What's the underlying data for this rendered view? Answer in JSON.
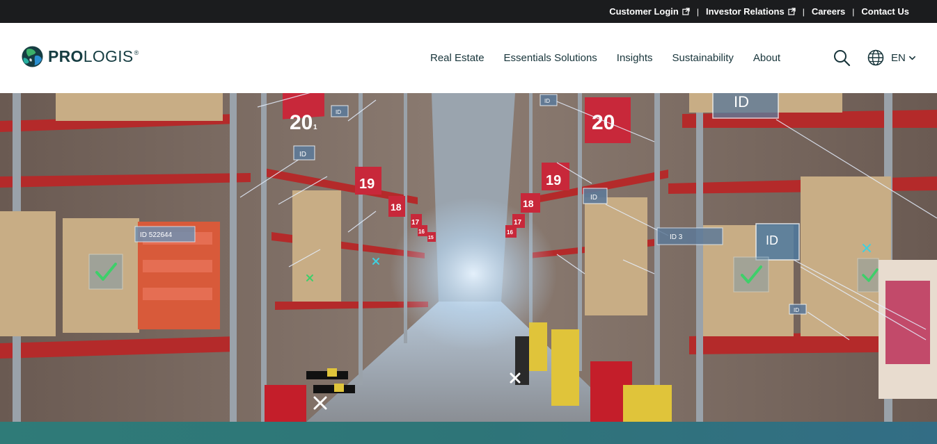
{
  "utility_nav": {
    "links": [
      {
        "label": "Customer Login",
        "external": true
      },
      {
        "label": "Investor Relations",
        "external": true
      },
      {
        "label": "Careers",
        "external": false
      },
      {
        "label": "Contact Us",
        "external": false
      }
    ],
    "separator": "|"
  },
  "brand": {
    "name_bold": "PRO",
    "name_regular": "LOGIS",
    "registered": "®",
    "colors": {
      "dark": "#163d42",
      "teal": "#1f8a7a",
      "blue": "#2a6fb0",
      "green": "#3cb06a"
    }
  },
  "main_nav": {
    "items": [
      "Real Estate",
      "Essentials Solutions",
      "Insights",
      "Sustainability",
      "About"
    ]
  },
  "language": {
    "current": "EN"
  },
  "icons": {
    "search": "search-icon",
    "globe": "globe-icon",
    "chevron": "chevron-down-icon",
    "external": "external-link-icon"
  },
  "hero": {
    "overlay_tags": {
      "left_tag": "ID 522644",
      "right_tag": "ID 3",
      "id_small": "ID",
      "id_large": "ID",
      "rack_numbers": [
        "20",
        "19",
        "18",
        "17",
        "16",
        "15",
        "20",
        "19",
        "18",
        "17",
        "16"
      ],
      "rack_sub": "1"
    }
  }
}
